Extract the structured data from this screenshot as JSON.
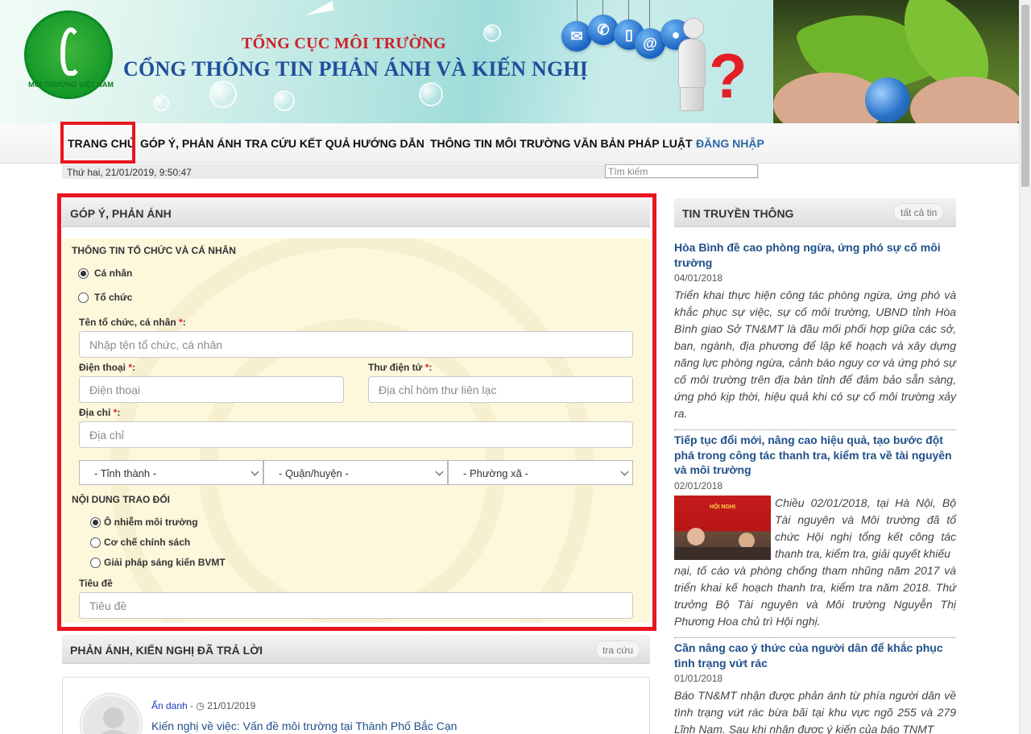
{
  "banner": {
    "org": "TỔNG CỤC MÔI TRƯỜNG",
    "portal": "CỔNG THÔNG TIN PHẢN ÁNH VÀ KIẾN NGHỊ",
    "logo_text": "MÔI TRƯỜNG VIỆT NAM"
  },
  "nav": {
    "items": [
      "TRANG CHỦ",
      "GÓP Ý, PHẢN ÁNH",
      "TRA CỨU KẾT QUẢ",
      "HƯỚNG DẪN",
      "THÔNG TIN MÔI TRƯỜNG",
      "VĂN BẢN PHÁP LUẬT"
    ],
    "login": "ĐĂNG NHẬP",
    "active": "TRANG CHỦ"
  },
  "datebar": {
    "date": "Thứ hai, 21/01/2019, 9:50:47",
    "search_placeholder": "Tìm kiếm"
  },
  "form": {
    "title": "GÓP Ý, PHẢN ÁNH",
    "section_info": "THÔNG TIN TỔ CHỨC VÀ CÁ NHÂN",
    "type_options": [
      "Cá nhân",
      "Tổ chức"
    ],
    "type_selected": "Cá nhân",
    "name_label": "Tên tổ chức, cá nhân",
    "name_placeholder": "Nhập tên tổ chức, cá nhân",
    "phone_label": "Điện thoại",
    "phone_placeholder": "Điện thoại",
    "email_label": "Thư điện tử",
    "email_placeholder": "Địa chỉ hòm thư liên lạc",
    "address_label": "Địa chỉ",
    "address_placeholder": "Địa chỉ",
    "required_mark": "*",
    "label_suffix": ":",
    "province": "- Tỉnh thành -",
    "district": "- Quận/huyện -",
    "ward": "- Phường xã -",
    "section_content": "NỘI DUNG TRAO ĐỔI",
    "topic_options": [
      "Ô nhiễm môi trường",
      "Cơ chế chính sách",
      "Giải pháp sáng kiến BVMT"
    ],
    "topic_selected": "Ô nhiễm môi trường",
    "subject_label": "Tiêu đề",
    "subject_placeholder": "Tiêu đề"
  },
  "answered": {
    "title": "PHẢN ÁNH, KIẾN NGHỊ ĐÃ TRẢ LỜI",
    "button": "tra cứu",
    "item": {
      "author": "Ẩn danh",
      "separator": " - ",
      "clock_icon": "clock-icon",
      "date": "21/01/2019",
      "title": "Kiến nghị về việc: Vấn đề môi trường tại Thành Phố Bắc Cạn"
    }
  },
  "news": {
    "title": "TIN TRUYỀN THÔNG",
    "button": "tất cả tin",
    "items": [
      {
        "title": "Hòa Bình đề cao phòng ngừa, ứng phó sự cố môi trường",
        "date": "04/01/2018",
        "summary": "Triển khai thực hiện công tác phòng ngừa, ứng phó và khắc phục sự việc, sự cố môi trường, UBND tỉnh Hòa Bình giao Sở TN&MT là đầu mối phối hợp giữa các sở, ban, ngành, địa phương để lập kế hoạch và xây dựng năng lực phòng ngừa, cảnh báo nguy cơ và ứng phó sự cố môi trường trên địa bàn tỉnh để đảm bảo sẵn sàng, ứng phó kịp thời, hiệu quả khi có sự cố môi trường xảy ra."
      },
      {
        "title": "Tiếp tục đổi mới, nâng cao hiệu quả, tạo bước đột phá trong công tác thanh tra, kiểm tra về tài nguyên và môi trường",
        "date": "02/01/2018",
        "summary_beside": "Chiều 02/01/2018, tại Hà Nội, Bộ Tài nguyên và Môi trường đã tổ chức Hội nghị tổng kết công tác thanh tra, kiểm tra, giải quyết khiếu",
        "summary_below": "nại, tố cáo và phòng chống tham nhũng năm 2017 và triển khai kế hoạch thanh tra, kiểm tra năm 2018. Thứ trưởng Bộ Tài nguyên và Môi trường Nguyễn Thị Phương Hoa chủ trì Hội nghị.",
        "thumb_caption": "HỘI NGHỊ"
      },
      {
        "title": "Cần nâng cao ý thức của người dân để khắc phục tình trạng vứt rác",
        "date": "01/01/2018",
        "summary": "Báo TN&MT nhận được phản ánh từ phía người dân về tình trạng vứt rác bừa bãi tại khu vực ngõ 255 và 279 Lĩnh Nam. Sau khi nhận được ý kiến của báo TNMT"
      }
    ]
  },
  "icons": {
    "banner_balls": [
      "mail-icon",
      "phone-icon",
      "mobile-icon",
      "at-icon",
      "chat-icon"
    ]
  },
  "colors": {
    "highlight_red": "#e8161f",
    "link_blue": "#1f4f8a",
    "banner_blue": "#1f4f9a",
    "banner_red": "#d0202a",
    "form_bg": "#fdf7dc"
  }
}
